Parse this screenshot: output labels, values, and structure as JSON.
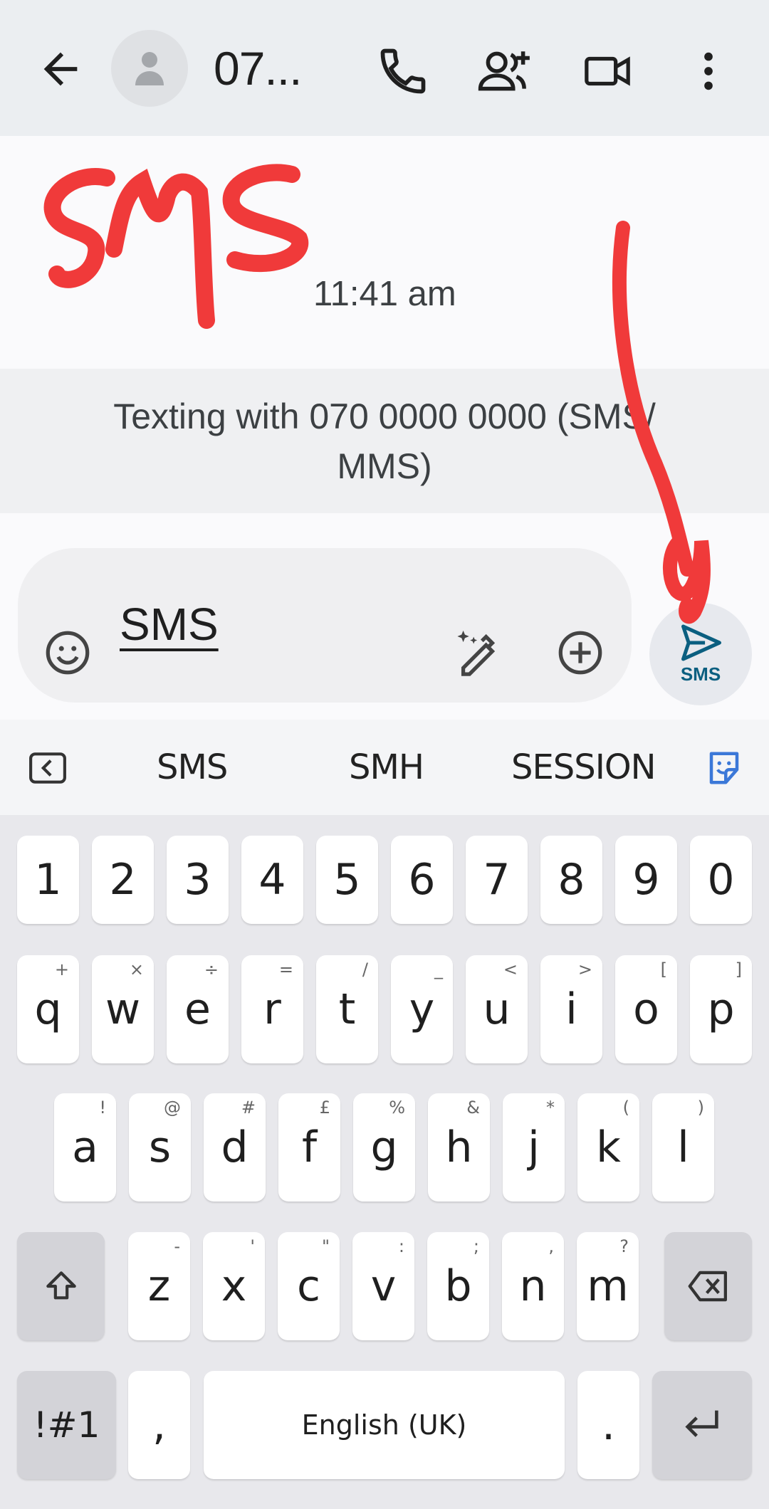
{
  "header": {
    "contact_name": "07...",
    "icons": [
      "back-arrow-icon",
      "avatar-person-icon",
      "phone-icon",
      "add-person-icon",
      "video-call-icon",
      "more-vert-icon"
    ]
  },
  "conversation": {
    "timestamp": "11:41 am",
    "info_line1": "Texting with 070 0000 0000 (SMS/",
    "info_line2": "MMS)",
    "annotation_text": "SMS"
  },
  "compose": {
    "text": "SMS",
    "send_label": "SMS"
  },
  "suggestions": [
    "SMS",
    "SMH",
    "SESSION"
  ],
  "keyboard": {
    "row_numbers": [
      "1",
      "2",
      "3",
      "4",
      "5",
      "6",
      "7",
      "8",
      "9",
      "0"
    ],
    "row1": [
      {
        "k": "q",
        "s": "+"
      },
      {
        "k": "w",
        "s": "×"
      },
      {
        "k": "e",
        "s": "÷"
      },
      {
        "k": "r",
        "s": "="
      },
      {
        "k": "t",
        "s": "/"
      },
      {
        "k": "y",
        "s": "_"
      },
      {
        "k": "u",
        "s": "<"
      },
      {
        "k": "i",
        "s": ">"
      },
      {
        "k": "o",
        "s": "["
      },
      {
        "k": "p",
        "s": "]"
      }
    ],
    "row2": [
      {
        "k": "a",
        "s": "!"
      },
      {
        "k": "s",
        "s": "@"
      },
      {
        "k": "d",
        "s": "#"
      },
      {
        "k": "f",
        "s": "£"
      },
      {
        "k": "g",
        "s": "%"
      },
      {
        "k": "h",
        "s": "&"
      },
      {
        "k": "j",
        "s": "*"
      },
      {
        "k": "k",
        "s": "("
      },
      {
        "k": "l",
        "s": ")"
      }
    ],
    "row3": [
      {
        "k": "z",
        "s": "-"
      },
      {
        "k": "x",
        "s": "'"
      },
      {
        "k": "c",
        "s": "\""
      },
      {
        "k": "v",
        "s": ":"
      },
      {
        "k": "b",
        "s": ";"
      },
      {
        "k": "n",
        "s": ","
      },
      {
        "k": "m",
        "s": "?"
      }
    ],
    "symbols_key": "!#1",
    "comma_key": ",",
    "space_label": "English (UK)",
    "period_key": "."
  },
  "colors": {
    "annotation": "#f03a3a",
    "send_accent": "#0b5f80",
    "sticker_accent": "#3b78d8"
  }
}
